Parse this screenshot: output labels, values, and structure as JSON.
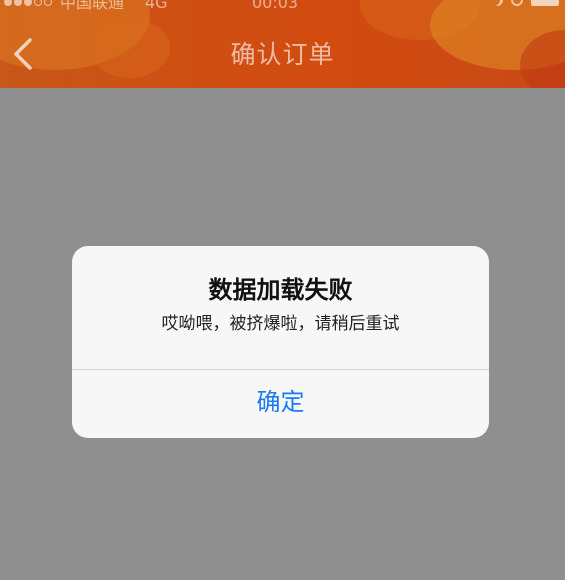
{
  "status_bar": {
    "carrier": "中国联通",
    "network": "4G",
    "time": "00:03"
  },
  "nav": {
    "title": "确认订单",
    "back_icon": "chevron-left-icon"
  },
  "alert": {
    "title": "数据加载失败",
    "message": "哎呦喂，被挤爆啦，请稍后重试",
    "confirm_label": "确定"
  },
  "colors": {
    "header_accent": "#d24b10",
    "overlay_background": "#8f8f8f",
    "alert_background": "#f7f7f7",
    "button_blue": "#1a7cf2"
  }
}
